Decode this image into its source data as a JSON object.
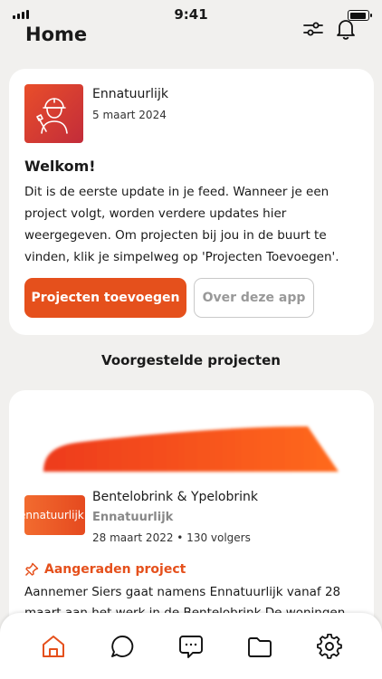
{
  "status_bar": {
    "time": "9:41"
  },
  "header": {
    "title": "Home"
  },
  "welcome_card": {
    "org_name": "Ennatuurlijk",
    "date": "5 maart 2024",
    "heading": "Welkom!",
    "body": "Dit is de eerste update in je feed. Wanneer je een project volgt, worden verdere updates hier weergegeven. Om projecten bij jou in de buurt te vinden, klik je simpelweg op 'Projecten Toevoegen'.",
    "primary_button": "Projecten toevoegen",
    "secondary_button": "Over deze app"
  },
  "suggested": {
    "heading": "Voorgestelde projecten",
    "project": {
      "thumb_text": "ennatuurlijk",
      "name": "Bentelobrink & Ypelobrink",
      "org": "Ennatuurlijk",
      "meta": "28 maart 2022 • 130 volgers",
      "badge": "Aangeraden project",
      "body": "Aannemer Siers gaat namens Ennatuurlijk vanaf 28 maart aan het werk in de Bentelobrink De woningen"
    }
  },
  "colors": {
    "accent": "#e5501c",
    "background": "#f1f0ee"
  },
  "icons": {
    "header": [
      "sliders-icon",
      "bell-icon"
    ],
    "tabs": [
      "home-icon",
      "chat-icon",
      "messages-icon",
      "folder-icon",
      "gear-icon"
    ]
  }
}
